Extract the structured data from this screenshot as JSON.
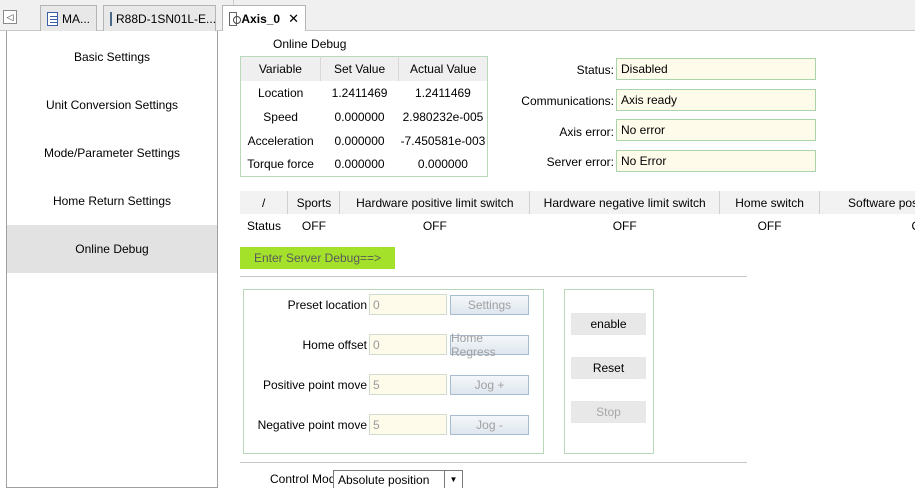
{
  "tabs": {
    "scroll_left": "◁",
    "items": [
      {
        "label": "MA...",
        "icon": "document-icon"
      },
      {
        "label": "R88D-1SN01L-E...",
        "icon": "device-icon"
      },
      {
        "label": "Axis_0",
        "icon": "axis-icon",
        "active": true
      }
    ],
    "close_symbol": "✕"
  },
  "sidebar": {
    "items": [
      {
        "label": "Basic Settings"
      },
      {
        "label": "Unit Conversion Settings"
      },
      {
        "label": "Mode/Parameter Settings"
      },
      {
        "label": "Home Return Settings"
      },
      {
        "label": "Online Debug",
        "active": true
      }
    ]
  },
  "online_debug": {
    "title": "Online Debug",
    "variables_table": {
      "headers": [
        "Variable",
        "Set Value",
        "Actual Value"
      ],
      "rows": [
        [
          "Location",
          "1.2411469",
          "1.2411469"
        ],
        [
          "Speed",
          "0.000000",
          "2.980232e-005"
        ],
        [
          "Acceleration",
          "0.000000",
          "-7.450581e-003"
        ],
        [
          "Torque force",
          "0.000000",
          "0.000000"
        ]
      ]
    },
    "status": {
      "status_label": "Status:",
      "status_value": "Disabled",
      "communications_label": "Communications:",
      "communications_value": "Axis ready",
      "axis_error_label": "Axis error:",
      "axis_error_value": "No error",
      "server_error_label": "Server error:",
      "server_error_value": "No Error"
    },
    "switch_table": {
      "headers": [
        "/",
        "Sports",
        "Hardware positive limit switch",
        "Hardware negative limit switch",
        "Home switch",
        "Software posit"
      ],
      "row_label": "Status",
      "values": [
        "OFF",
        "OFF",
        "OFF",
        "OFF",
        "O"
      ]
    },
    "enter_server_debug": "Enter Server Debug==>",
    "motion": {
      "preset_location_label": "Preset location",
      "preset_location_value": "0",
      "settings_button": "Settings",
      "home_offset_label": "Home offset",
      "home_offset_value": "0",
      "home_regress_button": "Home Regress",
      "positive_move_label": "Positive point move",
      "positive_move_value": "5",
      "jog_plus_button": "Jog +",
      "negative_move_label": "Negative point move",
      "negative_move_value": "5",
      "jog_minus_button": "Jog -"
    },
    "servo": {
      "enable_button": "enable",
      "reset_button": "Reset",
      "stop_button": "Stop"
    },
    "control_mode": {
      "label": "Control Mode",
      "selected": "Absolute position"
    }
  }
}
